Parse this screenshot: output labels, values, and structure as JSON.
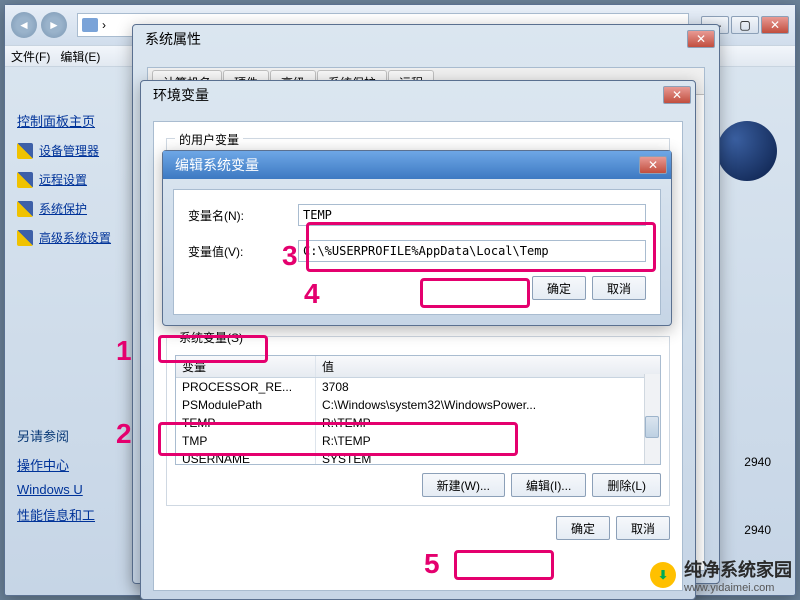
{
  "explorer": {
    "menubar": [
      "文件(F)",
      "编辑(E)"
    ],
    "win_min": "—",
    "win_max": "▢",
    "win_close": "✕",
    "chev": "›"
  },
  "leftnav": {
    "home": "控制面板主页",
    "items": [
      {
        "label": "设备管理器"
      },
      {
        "label": "远程设置"
      },
      {
        "label": "系统保护"
      },
      {
        "label": "高级系统设置"
      }
    ],
    "seealso": "另请参阅",
    "links": [
      "操作中心",
      "Windows U",
      "性能信息和工"
    ]
  },
  "rightpane": {
    "num1": "2940",
    "num2": "2940"
  },
  "sysprops": {
    "title": "系统属性",
    "tabs": [
      "计算机名",
      "硬件",
      "高级",
      "系统保护",
      "远程"
    ]
  },
  "envvars": {
    "title": "环境变量",
    "user_legend_prefix": "的用户变量",
    "sys_legend": "系统变量(S)",
    "col_var": "变量",
    "col_val": "值",
    "sys_rows": [
      {
        "v": "PROCESSOR_RE...",
        "val": "3708"
      },
      {
        "v": "PSModulePath",
        "val": "C:\\Windows\\system32\\WindowsPower..."
      },
      {
        "v": "TEMP",
        "val": "R:\\TEMP"
      },
      {
        "v": "TMP",
        "val": "R:\\TEMP"
      },
      {
        "v": "USERNAME",
        "val": "SYSTEM"
      }
    ],
    "btn_new": "新建(W)...",
    "btn_edit": "编辑(I)...",
    "btn_del": "删除(L)",
    "btn_ok": "确定",
    "btn_cancel": "取消"
  },
  "editvar": {
    "title": "编辑系统变量",
    "lbl_name": "变量名(N):",
    "lbl_value": "变量值(V):",
    "name": "TEMP",
    "value": "C:\\%USERPROFILE%AppData\\Local\\Temp",
    "btn_ok": "确定",
    "btn_cancel": "取消"
  },
  "annotations": {
    "n1": "1",
    "n2": "2",
    "n3": "3",
    "n4": "4",
    "n5": "5"
  },
  "watermark": {
    "brand": "纯净系统家园",
    "url": "www.yidaimei.com",
    "arrow": "⬇"
  }
}
